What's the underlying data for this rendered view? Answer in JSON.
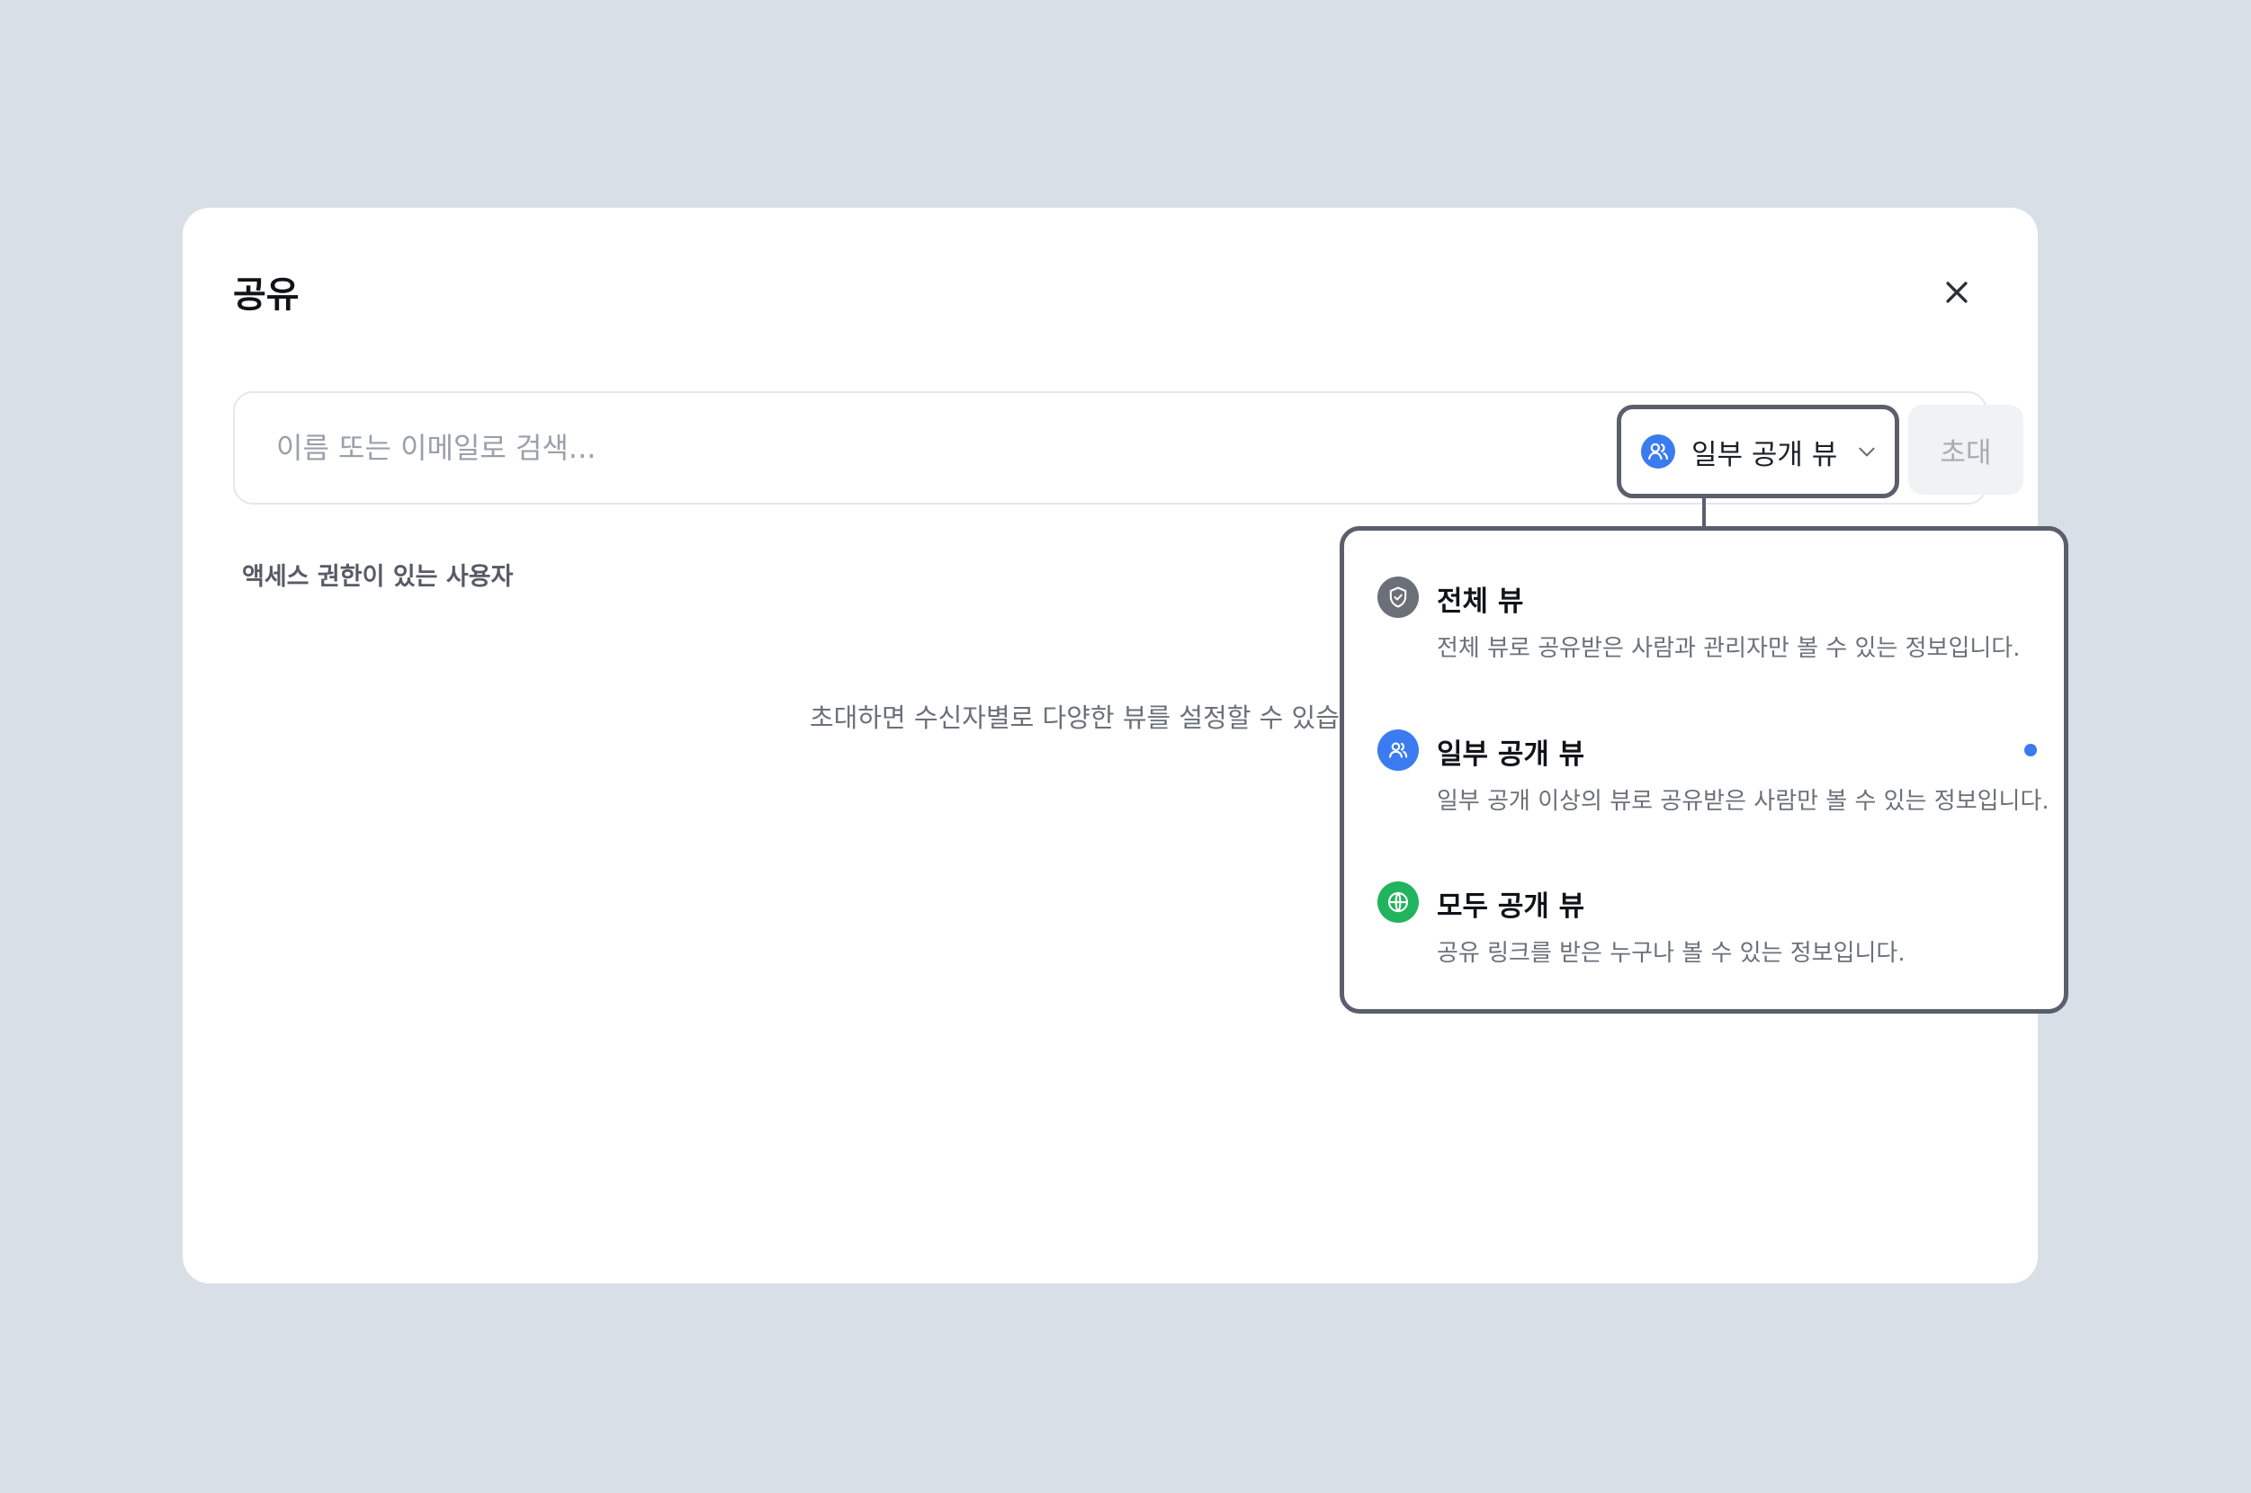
{
  "dialog": {
    "title": "공유"
  },
  "search": {
    "placeholder": "이름 또는 이메일로 검색...",
    "value": ""
  },
  "view_select": {
    "selected_label": "일부 공개 뷰",
    "selected_icon": "users-icon",
    "selected_color": "#3b7bf0"
  },
  "invite_button": {
    "label": "초대"
  },
  "access": {
    "section_label": "액세스 권한이 있는 사용자",
    "empty_message": "초대하면 수신자별로 다양한 뷰를 설정할 수 있습"
  },
  "dropdown": {
    "options": [
      {
        "label": "전체 뷰",
        "description": "전체 뷰로 공유받은 사람과 관리자만 볼 수 있는 정보입니다.",
        "icon": "shield-check-icon",
        "color": "#6b6f78",
        "selected": false
      },
      {
        "label": "일부 공개 뷰",
        "description": "일부 공개 이상의 뷰로 공유받은 사람만 볼 수 있는 정보입니다.",
        "icon": "users-icon",
        "color": "#3b7bf0",
        "selected": true
      },
      {
        "label": "모두 공개 뷰",
        "description": "공유 링크를 받은 누구나 볼 수 있는 정보입니다.",
        "icon": "globe-icon",
        "color": "#22b35e",
        "selected": false
      }
    ]
  }
}
